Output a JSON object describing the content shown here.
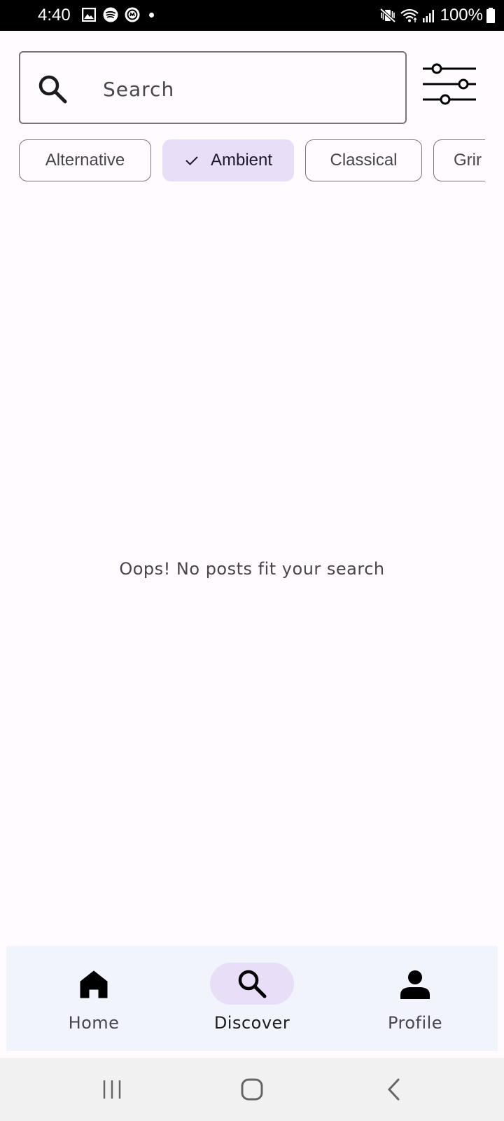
{
  "status_bar": {
    "time": "4:40",
    "battery": "100%",
    "left_icons": [
      "gallery-icon",
      "spotify-icon",
      "messaging-app-icon",
      "notification-dot"
    ],
    "right_icons": [
      "mute-vibrate-icon",
      "wifi-icon",
      "signal-icon",
      "battery-icon"
    ]
  },
  "search": {
    "placeholder": "Search",
    "value": ""
  },
  "filter_button_icon": "sliders-icon",
  "chips": [
    {
      "label": "Alternative",
      "selected": false
    },
    {
      "label": "Ambient",
      "selected": true
    },
    {
      "label": "Classical",
      "selected": false
    },
    {
      "label": "Grir",
      "selected": false
    }
  ],
  "empty_message": "Oops! No posts fit your search",
  "bottom_nav": {
    "items": [
      {
        "label": "Home",
        "icon": "home-icon",
        "active": false
      },
      {
        "label": "Discover",
        "icon": "search-icon",
        "active": true
      },
      {
        "label": "Profile",
        "icon": "person-icon",
        "active": false
      }
    ]
  },
  "system_nav": [
    "recents-icon",
    "home-circle-icon",
    "back-icon"
  ],
  "colors": {
    "background": "#fffbfe",
    "outline": "#79747e",
    "selected_chip": "#e8def8",
    "nav_background": "#f1f4fb",
    "text_secondary": "#49454f"
  }
}
